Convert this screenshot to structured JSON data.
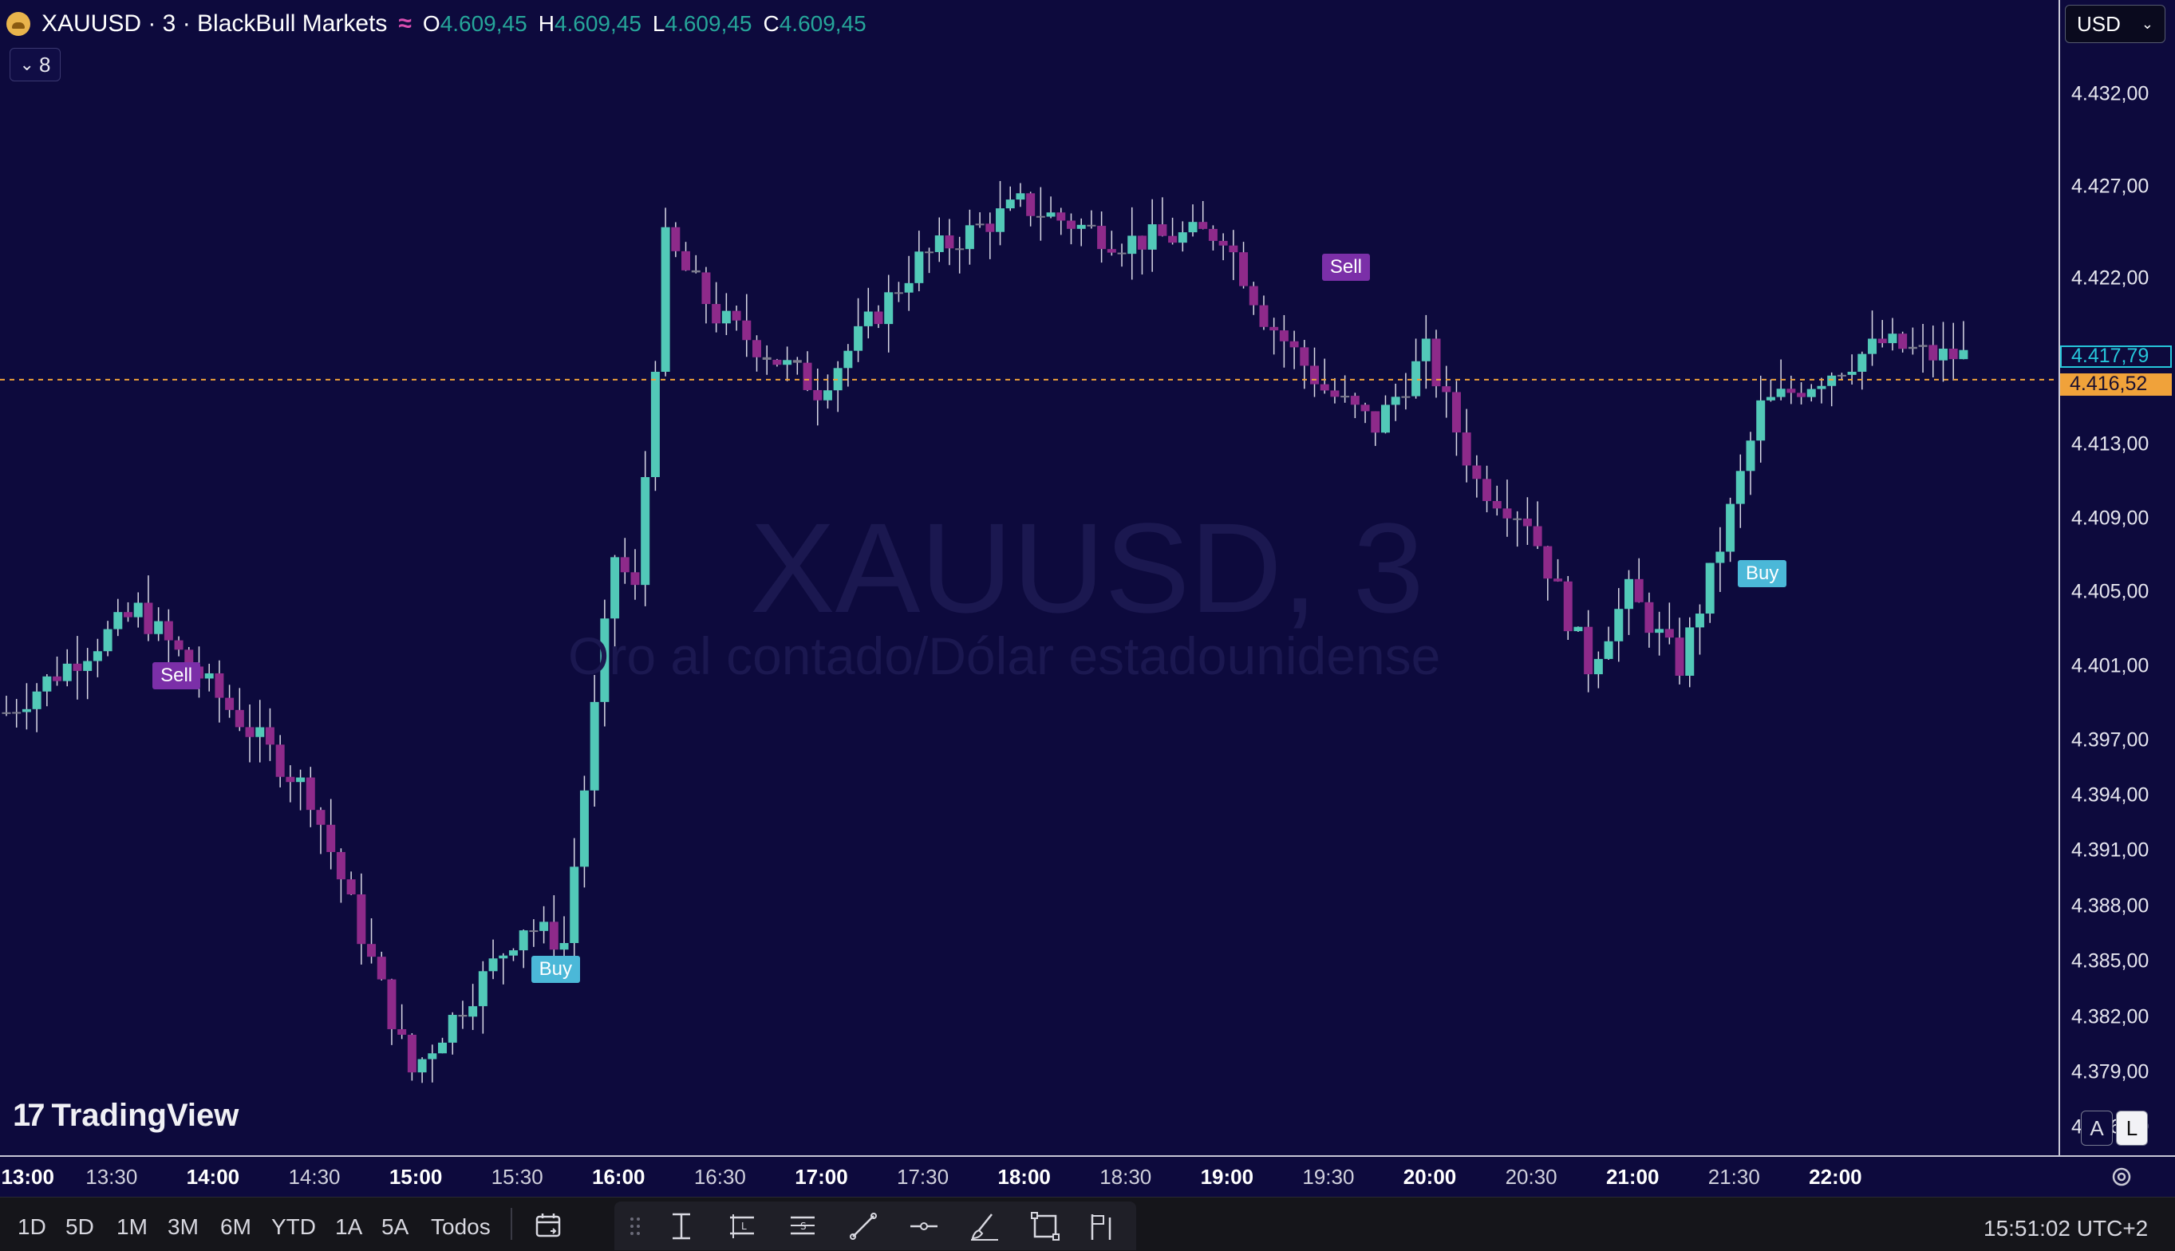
{
  "header": {
    "symbol_title": "XAUUSD · 3 · BlackBull Markets",
    "ohlc": [
      {
        "key": "O",
        "value": "4.609,45"
      },
      {
        "key": "H",
        "value": "4.609,45"
      },
      {
        "key": "L",
        "value": "4.609,45"
      },
      {
        "key": "C",
        "value": "4.609,45"
      }
    ],
    "indicator_count": "8"
  },
  "currency_selector": "USD",
  "watermark": {
    "symbol": "XAUUSD, 3",
    "description": "Oro al contado/Dólar estadounidense"
  },
  "branding": "TradingView",
  "price_axis": {
    "labels": [
      "4.432,00",
      "4.427,00",
      "4.422,00",
      "4.413,00",
      "4.409,00",
      "4.405,00",
      "4.401,00",
      "4.397,00",
      "4.394,00",
      "4.391,00",
      "4.388,00",
      "4.385,00",
      "4.382,00",
      "4.379,00",
      "4.376,00"
    ],
    "current_price": "4.417,79",
    "last_price": "4.416,52",
    "colors": {
      "current": "#26c6da",
      "last": "#f0a23a"
    }
  },
  "time_axis": {
    "labels": [
      {
        "text": "13:00",
        "bold": true
      },
      {
        "text": "13:30",
        "bold": false
      },
      {
        "text": "14:00",
        "bold": true
      },
      {
        "text": "14:30",
        "bold": false
      },
      {
        "text": "15:00",
        "bold": true
      },
      {
        "text": "15:30",
        "bold": false
      },
      {
        "text": "16:00",
        "bold": true
      },
      {
        "text": "16:30",
        "bold": false
      },
      {
        "text": "17:00",
        "bold": true
      },
      {
        "text": "17:30",
        "bold": false
      },
      {
        "text": "18:00",
        "bold": true
      },
      {
        "text": "18:30",
        "bold": false
      },
      {
        "text": "19:00",
        "bold": true
      },
      {
        "text": "19:30",
        "bold": false
      },
      {
        "text": "20:00",
        "bold": true
      },
      {
        "text": "20:30",
        "bold": false
      },
      {
        "text": "21:00",
        "bold": true
      },
      {
        "text": "21:30",
        "bold": false
      },
      {
        "text": "22:00",
        "bold": true
      }
    ]
  },
  "signals": [
    {
      "type": "sell",
      "label": "Sell",
      "time": "13:44"
    },
    {
      "type": "buy",
      "label": "Buy",
      "time": "15:36"
    },
    {
      "type": "sell",
      "label": "Sell",
      "time": "19:30"
    },
    {
      "type": "buy",
      "label": "Buy",
      "time": "21:33"
    }
  ],
  "scale_toggles": {
    "auto": "A",
    "log": "L"
  },
  "range_buttons": [
    "1D",
    "5D",
    "1M",
    "3M",
    "6M",
    "YTD",
    "1A",
    "5A",
    "Todos"
  ],
  "clock": "15:51:02 UTC+2",
  "colors": {
    "background": "#0d0a3d",
    "bull": "#52c9b8",
    "bear": "#8e2a8a",
    "neutral": "#7d7d8e"
  },
  "chart_data": {
    "type": "candlestick",
    "interval": "3m",
    "y_range": [
      4374.5,
      4434.5
    ],
    "x_range": [
      "12:57",
      "23:06"
    ],
    "key_points": [
      {
        "time": "13:00",
        "price": 4398.5
      },
      {
        "time": "13:39",
        "price": 4404.0
      },
      {
        "time": "14:30",
        "price": 4394.0
      },
      {
        "time": "15:00",
        "price": 4379.0
      },
      {
        "time": "15:33",
        "price": 4387.0
      },
      {
        "time": "15:45",
        "price": 4386.0
      },
      {
        "time": "16:00",
        "price": 4407.0
      },
      {
        "time": "16:06",
        "price": 4405.0
      },
      {
        "time": "16:15",
        "price": 4424.0
      },
      {
        "time": "16:30",
        "price": 4420.0
      },
      {
        "time": "17:00",
        "price": 4416.0
      },
      {
        "time": "17:30",
        "price": 4423.0
      },
      {
        "time": "18:00",
        "price": 4426.0
      },
      {
        "time": "18:30",
        "price": 4424.0
      },
      {
        "time": "19:00",
        "price": 4424.5
      },
      {
        "time": "19:12",
        "price": 4420.0
      },
      {
        "time": "19:30",
        "price": 4416.0
      },
      {
        "time": "19:45",
        "price": 4414.0
      },
      {
        "time": "20:00",
        "price": 4418.0
      },
      {
        "time": "20:15",
        "price": 4411.0
      },
      {
        "time": "20:30",
        "price": 4409.0
      },
      {
        "time": "20:48",
        "price": 4401.0
      },
      {
        "time": "21:00",
        "price": 4405.0
      },
      {
        "time": "21:15",
        "price": 4401.0
      },
      {
        "time": "21:27",
        "price": 4407.5
      },
      {
        "time": "21:39",
        "price": 4415.0
      },
      {
        "time": "22:00",
        "price": 4417.0
      },
      {
        "time": "22:15",
        "price": 4418.5
      },
      {
        "time": "22:30",
        "price": 4417.8
      }
    ]
  }
}
